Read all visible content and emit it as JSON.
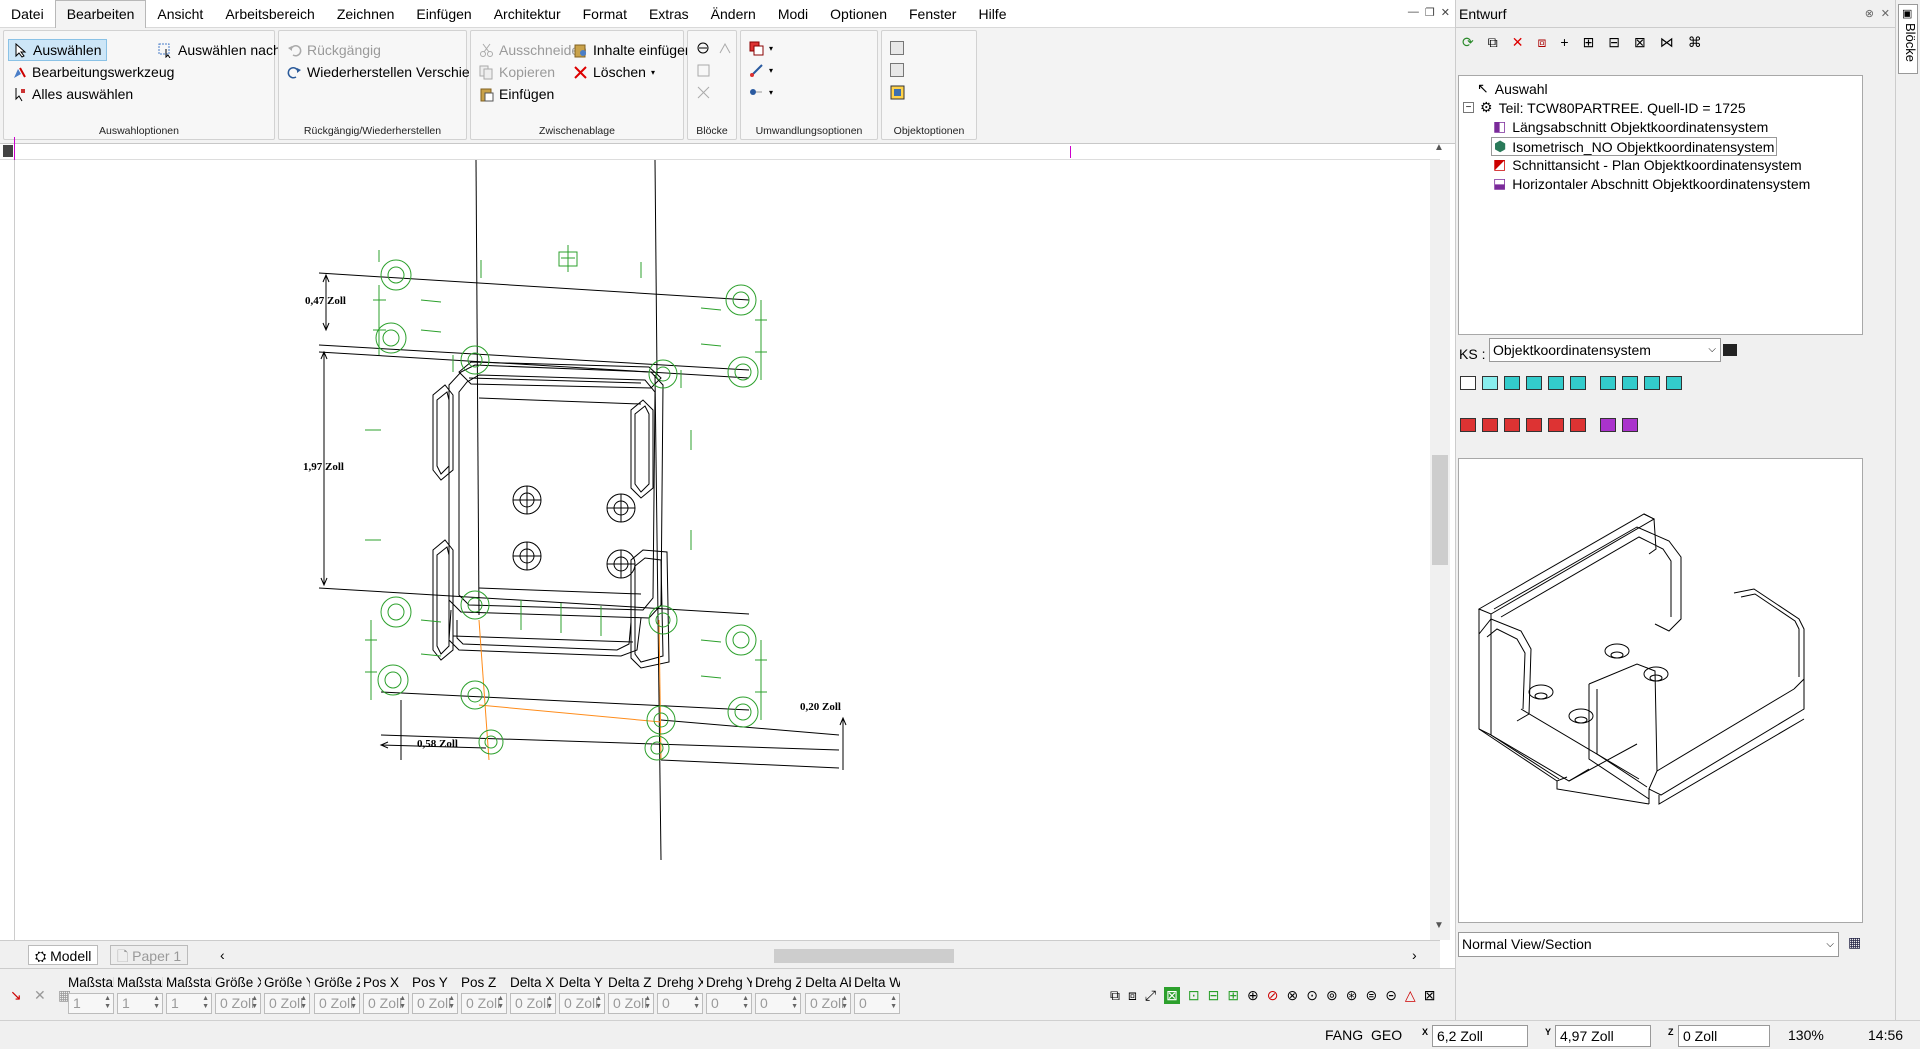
{
  "menubar": {
    "items": [
      "Datei",
      "Bearbeiten",
      "Ansicht",
      "Arbeitsbereich",
      "Zeichnen",
      "Einfügen",
      "Architektur",
      "Format",
      "Extras",
      "Ändern",
      "Modi",
      "Optionen",
      "Fenster",
      "Hilfe"
    ],
    "active": "Bearbeiten"
  },
  "ribbon": {
    "auswahl": {
      "title": "Auswahloptionen",
      "auswaehlen": "Auswählen",
      "bearbeitungswerkzeug": "Bearbeitungswerkzeug",
      "alles_auswaehlen": "Alles auswählen",
      "auswaehlen_nach": "Auswählen nach"
    },
    "undo": {
      "title": "Rückgängig/Wiederherstellen",
      "rueckgaengig": "Rückgängig",
      "wiederherstellen": "Wiederherstellen Verschieben"
    },
    "clipboard": {
      "title": "Zwischenablage",
      "ausschneiden": "Ausschneiden",
      "kopieren": "Kopieren",
      "einfuegen": "Einfügen",
      "inhalte_einfuegen": "Inhalte einfügen",
      "loeschen": "Löschen"
    },
    "bloecke": {
      "title": "Blöcke"
    },
    "umwandlung": {
      "title": "Umwandlungsoptionen"
    },
    "objekt": {
      "title": "Objektoptionen"
    }
  },
  "drawing": {
    "dims": [
      "0,47 Zoll",
      "1,97 Zoll",
      "0,20 Zoll",
      "0,58 Zoll"
    ]
  },
  "tabs": {
    "modell": "Modell",
    "paper": "Paper 1"
  },
  "propbar": {
    "labels": [
      "Maßstab X",
      "Maßstab Y",
      "Maßstab Z",
      "Größe X",
      "Größe Y",
      "Größe Z",
      "Pos X",
      "Pos Y",
      "Pos Z",
      "Delta X",
      "Delta Y",
      "Delta Z",
      "Drehg X",
      "Drehg Y",
      "Drehg Z",
      "Delta Ab",
      "Delta W"
    ],
    "values": [
      "1",
      "1",
      "1",
      "0 Zoll",
      "0 Zoll",
      "0 Zoll",
      "0 Zoll",
      "0 Zoll",
      "0 Zoll",
      "0 Zoll",
      "0 Zoll",
      "0 Zoll",
      "0",
      "0",
      "0",
      "0 Zoll",
      "0"
    ]
  },
  "status": {
    "fang": "FANG",
    "geo": "GEO",
    "x": "6,2 Zoll",
    "y": "4,97 Zoll",
    "z": "0 Zoll",
    "zoom": "130%",
    "time": "14:56"
  },
  "panel": {
    "title": "Entwurf",
    "side_tab": "Blöcke",
    "tree": {
      "auswahl": "Auswahl",
      "teil": "Teil: TCW80PARTREE. Quell-ID = 1725",
      "children": [
        "Längsabschnitt Objektkoordinatensystem",
        "Isometrisch_NO Objektkoordinatensystem",
        "Schnittansicht - Plan Objektkoordinatensystem",
        "Horizontaler Abschnitt Objektkoordinatensystem"
      ]
    },
    "ks_label": "KS :",
    "ks_value": "Objektkoordinatensystem",
    "view_value": "Normal View/Section"
  },
  "colors": {
    "green": "#2ca02c",
    "orange": "#ff8c1a",
    "selection": "#cde6f7"
  }
}
